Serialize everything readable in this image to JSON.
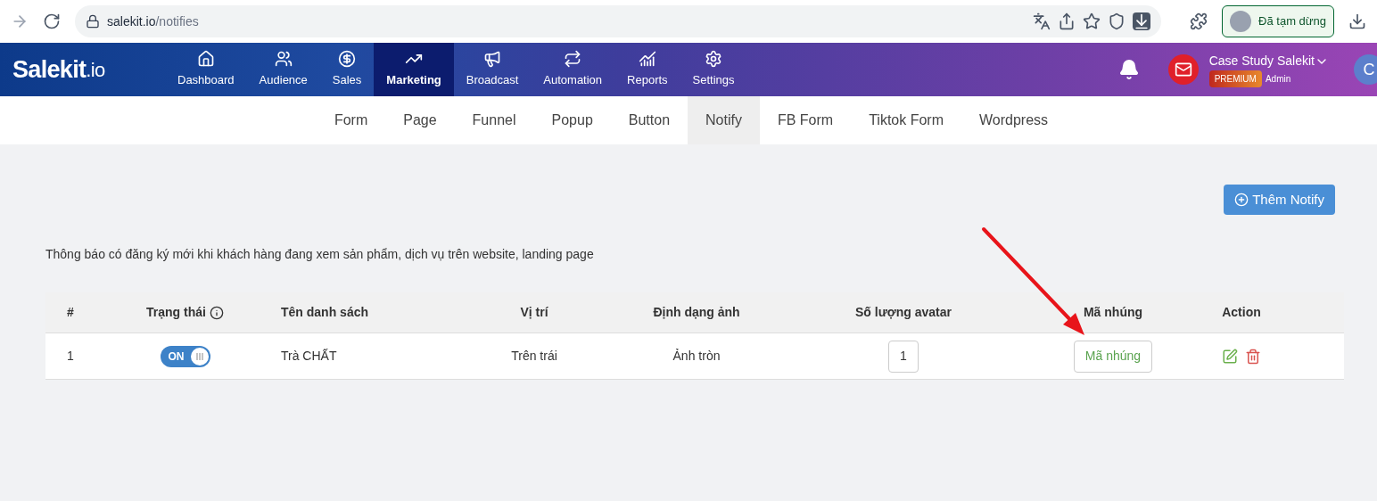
{
  "browser": {
    "url_host": "salekit.io",
    "url_path": "/notifies",
    "profile_label": "Đã tạm dừng"
  },
  "header": {
    "logo_main": "Salekit",
    "logo_suffix": ".io",
    "nav": [
      {
        "label": "Dashboard",
        "selected": false
      },
      {
        "label": "Audience",
        "selected": false
      },
      {
        "label": "Sales",
        "selected": false
      },
      {
        "label": "Marketing",
        "selected": true
      },
      {
        "label": "Broadcast",
        "selected": false
      },
      {
        "label": "Automation",
        "selected": false
      },
      {
        "label": "Reports",
        "selected": false
      },
      {
        "label": "Settings",
        "selected": false
      }
    ],
    "account_name": "Case Study Salekit",
    "plan_badge": "PREMIUM",
    "role": "Admin",
    "avatar_letter": "C"
  },
  "subtabs": [
    {
      "label": "Form",
      "selected": false
    },
    {
      "label": "Page",
      "selected": false
    },
    {
      "label": "Funnel",
      "selected": false
    },
    {
      "label": "Popup",
      "selected": false
    },
    {
      "label": "Button",
      "selected": false
    },
    {
      "label": "Notify",
      "selected": true
    },
    {
      "label": "FB Form",
      "selected": false
    },
    {
      "label": "Tiktok Form",
      "selected": false
    },
    {
      "label": "Wordpress",
      "selected": false
    }
  ],
  "add_button": "Thêm Notify",
  "description": "Thông báo có đăng ký mới khi khách hàng đang xem sản phẩm, dịch vụ trên website, landing page",
  "table": {
    "columns": [
      "#",
      "Trạng thái",
      "Tên danh sách",
      "Vị trí",
      "Định dạng ảnh",
      "Số lượng avatar",
      "Mã nhúng",
      "Action"
    ],
    "rows": [
      {
        "index": "1",
        "on": true,
        "toggle_label": "ON",
        "name": "Trà CHẤT",
        "position": "Trên trái",
        "image_format": "Ảnh tròn",
        "avatar_count": "1",
        "embed_button": "Mã nhúng"
      }
    ]
  }
}
